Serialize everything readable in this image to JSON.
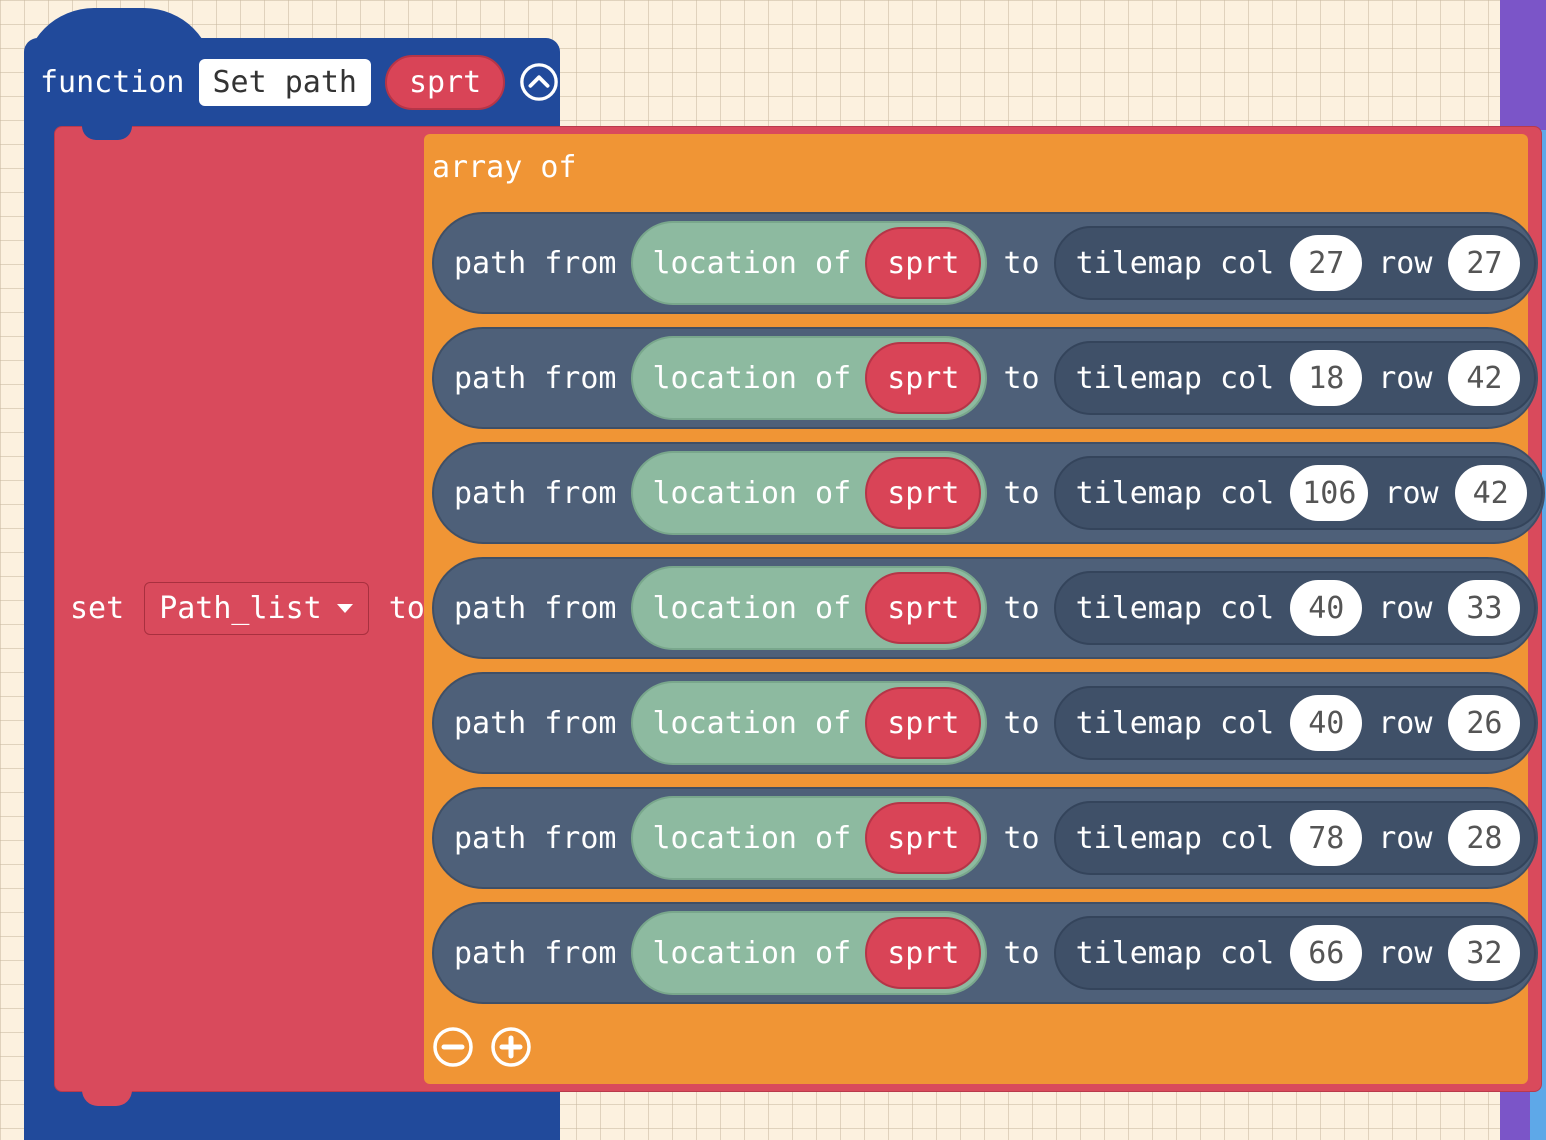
{
  "function_block": {
    "keyword": "function",
    "name": "Set path",
    "param": "sprt",
    "collapse_icon": "chevron-up-circle-icon",
    "color": "#214a9b"
  },
  "set_block": {
    "keyword_set": "set",
    "variable": "Path_list",
    "keyword_to": "to",
    "color": "#d94a5c"
  },
  "array_block": {
    "label": "array of",
    "color": "#f09535",
    "remove_icon": "minus-circle-icon",
    "add_icon": "plus-circle-icon"
  },
  "path_rows": [
    {
      "kw_path": "path",
      "kw_from": "from",
      "kw_location": "location of",
      "sprite": "sprt",
      "kw_to": "to",
      "kw_tilemap": "tilemap col",
      "col": "27",
      "kw_row": "row",
      "row": "27"
    },
    {
      "kw_path": "path",
      "kw_from": "from",
      "kw_location": "location of",
      "sprite": "sprt",
      "kw_to": "to",
      "kw_tilemap": "tilemap col",
      "col": "18",
      "kw_row": "row",
      "row": "42"
    },
    {
      "kw_path": "path",
      "kw_from": "from",
      "kw_location": "location of",
      "sprite": "sprt",
      "kw_to": "to",
      "kw_tilemap": "tilemap col",
      "col": "106",
      "kw_row": "row",
      "row": "42"
    },
    {
      "kw_path": "path",
      "kw_from": "from",
      "kw_location": "location of",
      "sprite": "sprt",
      "kw_to": "to",
      "kw_tilemap": "tilemap col",
      "col": "40",
      "kw_row": "row",
      "row": "33"
    },
    {
      "kw_path": "path",
      "kw_from": "from",
      "kw_location": "location of",
      "sprite": "sprt",
      "kw_to": "to",
      "kw_tilemap": "tilemap col",
      "col": "40",
      "kw_row": "row",
      "row": "26"
    },
    {
      "kw_path": "path",
      "kw_from": "from",
      "kw_location": "location of",
      "sprite": "sprt",
      "kw_to": "to",
      "kw_tilemap": "tilemap col",
      "col": "78",
      "kw_row": "row",
      "row": "28"
    },
    {
      "kw_path": "path",
      "kw_from": "from",
      "kw_location": "location of",
      "sprite": "sprt",
      "kw_to": "to",
      "kw_tilemap": "tilemap col",
      "col": "66",
      "kw_row": "row",
      "row": "32"
    }
  ]
}
